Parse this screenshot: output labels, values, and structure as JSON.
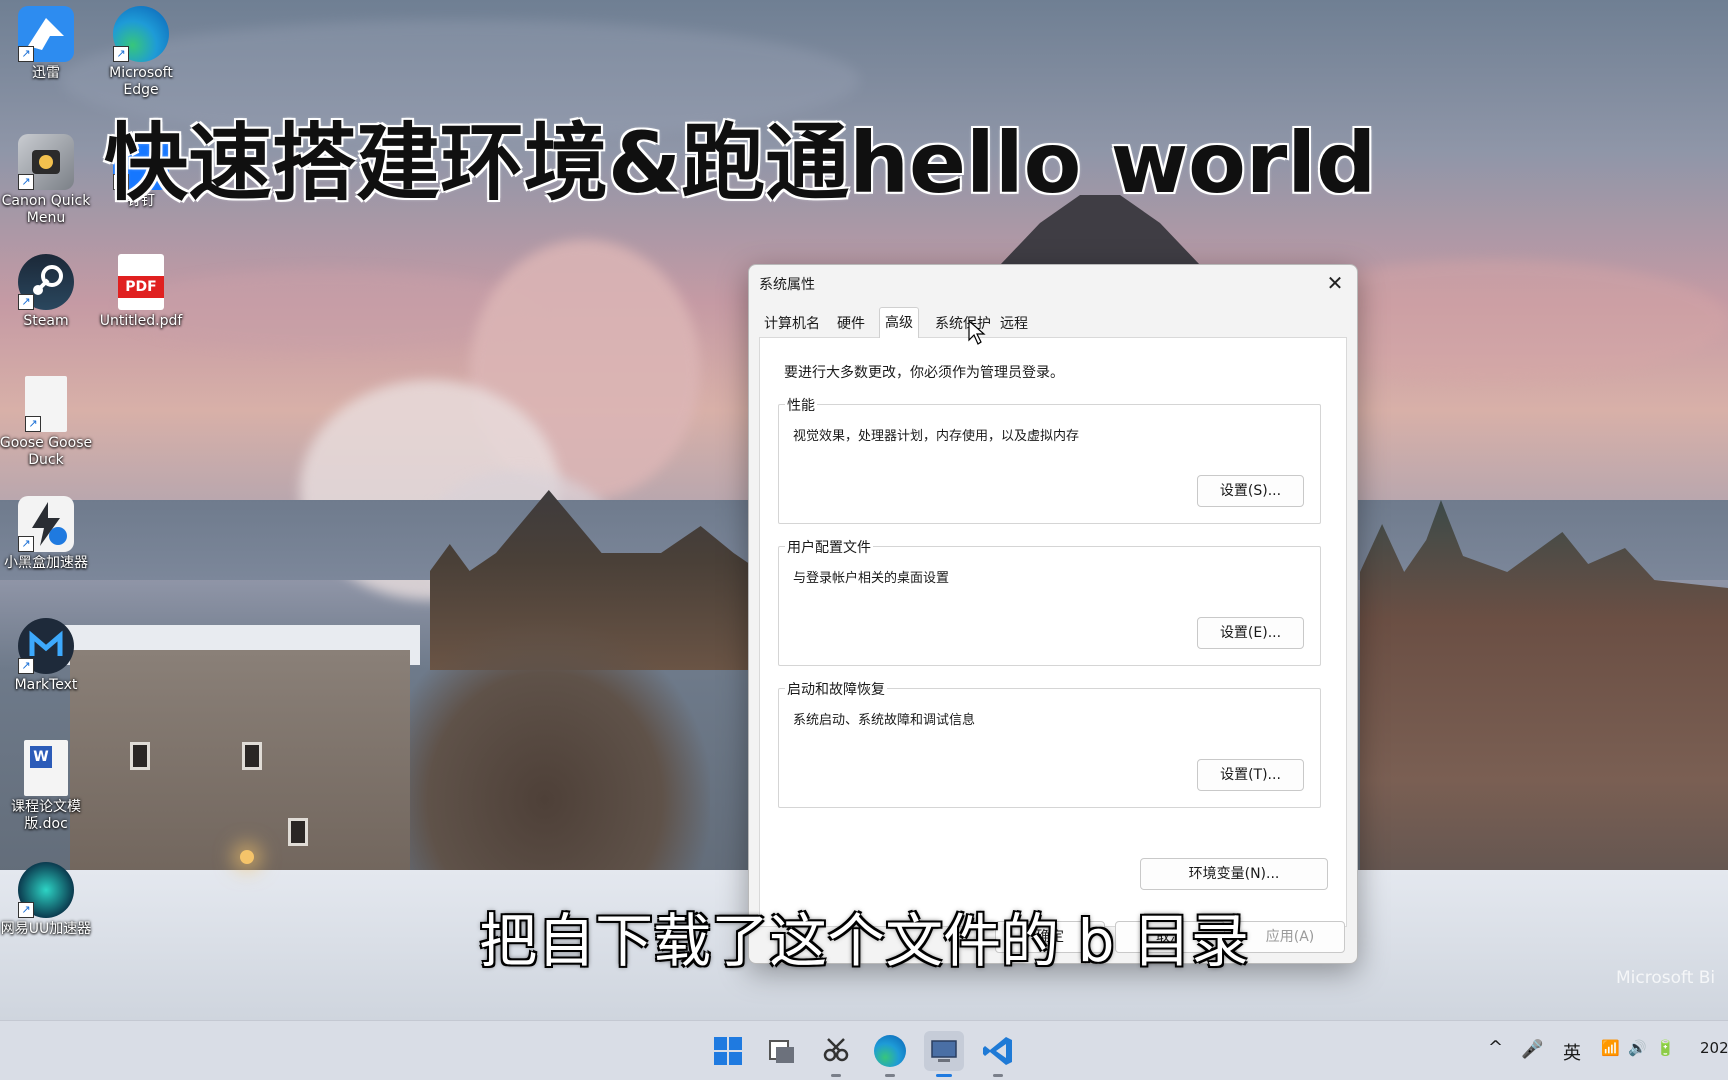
{
  "video": {
    "title": "快速搭建环境&跑通hello world",
    "subtitle": "把自下载了这个文件的 b 目录",
    "watermark": "Microsoft Bi"
  },
  "desktop": {
    "icons": [
      {
        "name": "xunlei",
        "label": "迅雷",
        "icon": "bird-icon",
        "color": "#2d8cf0"
      },
      {
        "name": "microsoft-edge",
        "label": "Microsoft Edge",
        "icon": "edge-icon",
        "color": "#1e9bd7"
      },
      {
        "name": "canon-quick-menu",
        "label": "Canon Quick Menu",
        "icon": "canon-icon",
        "color": "#8a8f96"
      },
      {
        "name": "dingtalk",
        "label": "钉钉",
        "icon": "dingtalk-icon",
        "color": "#1677ff"
      },
      {
        "name": "steam",
        "label": "Steam",
        "icon": "steam-icon",
        "color": "#1b2838"
      },
      {
        "name": "untitled-pdf",
        "label": "Untitled.pdf",
        "icon": "pdf-icon",
        "color": "#e02020"
      },
      {
        "name": "goose-goose-duck",
        "label": "Goose Goose Duck",
        "icon": "file-icon",
        "color": "#f4f4f4"
      },
      {
        "name": "xiaoheihe",
        "label": "小黑盒加速器",
        "icon": "lightning-icon",
        "color": "#2a2d33"
      },
      {
        "name": "marktext",
        "label": "MarkText",
        "icon": "marktext-icon",
        "color": "#1e2a3a"
      },
      {
        "name": "course-doc",
        "label": "课程论文模版.doc",
        "icon": "word-icon",
        "color": "#f4f4f4"
      },
      {
        "name": "netease-uu",
        "label": "网易UU加速器",
        "icon": "uu-icon",
        "color": "#0b3b4f"
      }
    ]
  },
  "dialog": {
    "title": "系统属性",
    "close_glyph": "✕",
    "tabs": [
      {
        "label": "计算机名",
        "active": false
      },
      {
        "label": "硬件",
        "active": false
      },
      {
        "label": "高级",
        "active": true
      },
      {
        "label": "系统保护",
        "active": false
      },
      {
        "label": "远程",
        "active": false
      }
    ],
    "note": "要进行大多数更改，你必须作为管理员登录。",
    "groups": {
      "performance": {
        "legend": "性能",
        "desc": "视觉效果，处理器计划，内存使用，以及虚拟内存",
        "button": "设置(S)..."
      },
      "user_profiles": {
        "legend": "用户配置文件",
        "desc": "与登录帐户相关的桌面设置",
        "button": "设置(E)..."
      },
      "startup_recovery": {
        "legend": "启动和故障恢复",
        "desc": "系统启动、系统故障和调试信息",
        "button": "设置(T)..."
      }
    },
    "env_button": "环境变量(N)...",
    "footer": {
      "ok": "确定",
      "cancel": "取消",
      "apply": "应用(A)"
    }
  },
  "taskbar": {
    "apps": [
      {
        "name": "start",
        "icon": "windows-icon",
        "color": "#1f7ae0"
      },
      {
        "name": "task-view",
        "icon": "task-view-icon",
        "color": "#5b606b"
      },
      {
        "name": "screenshot-tool",
        "icon": "snip-icon",
        "color": "#3b3f47"
      },
      {
        "name": "edge",
        "icon": "edge-icon",
        "color": "#1e9bd7"
      },
      {
        "name": "system-properties",
        "icon": "computer-icon",
        "color": "#4a6fa5"
      },
      {
        "name": "vscode",
        "icon": "vscode-icon",
        "color": "#1f7ad6"
      }
    ],
    "tray": {
      "chevron": "^",
      "mic": "🎤",
      "ime": "英",
      "wifi": "📶",
      "volume": "🔊",
      "battery": "🔋",
      "clock": "202"
    }
  }
}
